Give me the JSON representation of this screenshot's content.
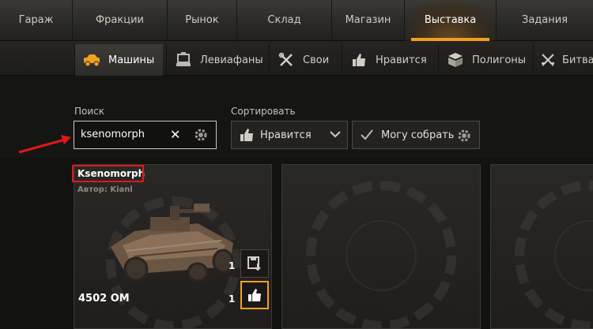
{
  "top_nav": {
    "tabs": [
      {
        "label": "Гараж"
      },
      {
        "label": "Фракции"
      },
      {
        "label": "Рынок"
      },
      {
        "label": "Склад"
      },
      {
        "label": "Магазин"
      },
      {
        "label": "Выставка",
        "active": true
      },
      {
        "label": "Задания"
      }
    ]
  },
  "sub_nav": {
    "tabs": [
      {
        "label": "Машины",
        "icon": "car-icon",
        "active": true
      },
      {
        "label": "Левиафаны",
        "icon": "leviathan-icon"
      },
      {
        "label": "Свои",
        "icon": "tools-icon"
      },
      {
        "label": "Нравится",
        "icon": "thumbs-up-icon"
      },
      {
        "label": "Полигоны",
        "icon": "blocks-icon"
      },
      {
        "label": "Битва",
        "icon": "battle-icon"
      }
    ]
  },
  "filters": {
    "search_label": "Поиск",
    "search_value": "ksenomorph",
    "sort_label": "Сортировать",
    "sort_value": "Нравится",
    "can_build_label": "Могу собрать"
  },
  "cards": [
    {
      "title": "Ksenomorph",
      "author": "Автор: Kianl",
      "price": "4502 ОМ",
      "saves_count": "1",
      "likes_count": "1"
    }
  ],
  "colors": {
    "accent": "#f0a020",
    "annotation": "#e01818"
  }
}
